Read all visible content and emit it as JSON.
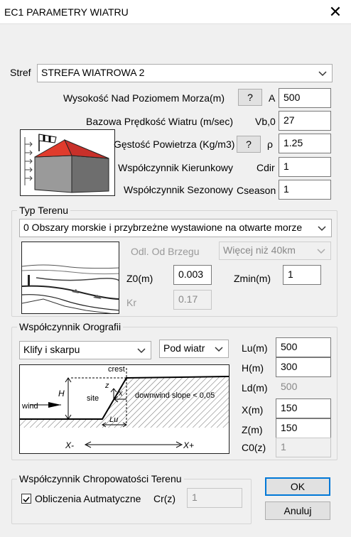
{
  "window": {
    "title": "EC1 PARAMETRY WIATRU"
  },
  "zone": {
    "label": "Stref",
    "value": "STREFA WIATROWA 2"
  },
  "params": {
    "altitude": {
      "label": "Wysokość Nad Poziomem Morza(m)",
      "help": "?",
      "symbol": "A",
      "value": "500"
    },
    "base_speed": {
      "label": "Bazowa Prędkość Wiatru (m/sec)",
      "symbol": "Vb,0",
      "value": "27"
    },
    "air_density": {
      "label": "Gęstość Powietrza (Kg/m3)",
      "help": "?",
      "symbol": "ρ",
      "value": "1.25"
    },
    "dir_factor": {
      "label": "Współczynnik Kierunkowy",
      "symbol": "Cdir",
      "value": "1"
    },
    "season_factor": {
      "label": "Współczynnik Sezonowy",
      "symbol": "Cseason",
      "value": "1"
    }
  },
  "terrain": {
    "group_title": "Typ Terenu",
    "category": "0 Obszary morskie i przybrzeżne wystawione na otwarte morze",
    "coast_distance_label": "Odl. Od Brzegu",
    "coast_distance_value": "Więcej niż 40km",
    "z0_label": "Z0(m)",
    "z0_value": "0.003",
    "zmin_label": "Zmin(m)",
    "zmin_value": "1",
    "kr_label": "Kr",
    "kr_value": "0.17"
  },
  "orography": {
    "group_title": "Współczynnik Orografii",
    "type": "Klify i skarpu",
    "direction": "Pod wiatr",
    "diagram": {
      "crest": "crest",
      "site": "site",
      "wind": "wind",
      "h": "H",
      "z": "z",
      "x": "x",
      "slope": "downwind slope < 0,05",
      "lu": "Lu",
      "xminus": "X-",
      "xplus": "X+"
    },
    "fields": [
      {
        "label": "Lu(m)",
        "value": "500",
        "readonly": false
      },
      {
        "label": "H(m)",
        "value": "300",
        "readonly": false
      },
      {
        "label": "Ld(m)",
        "value": "500",
        "readonly": true
      },
      {
        "label": "X(m)",
        "value": "150",
        "readonly": false
      },
      {
        "label": "Z(m)",
        "value": "150",
        "readonly": false
      },
      {
        "label": "C0(z)",
        "value": "1",
        "readonly": true
      }
    ]
  },
  "roughness": {
    "group_title": "Współczynnik Chropowatości Terenu",
    "auto_label": "Obliczenia Autmatyczne",
    "auto_checked": true,
    "cr_label": "Cr(z)",
    "cr_value": "1"
  },
  "buttons": {
    "ok": "OK",
    "cancel": "Anuluj"
  },
  "colors": {
    "accent": "#0078d7",
    "roof": "#e03b2c",
    "wall": "#8a8a8a"
  }
}
